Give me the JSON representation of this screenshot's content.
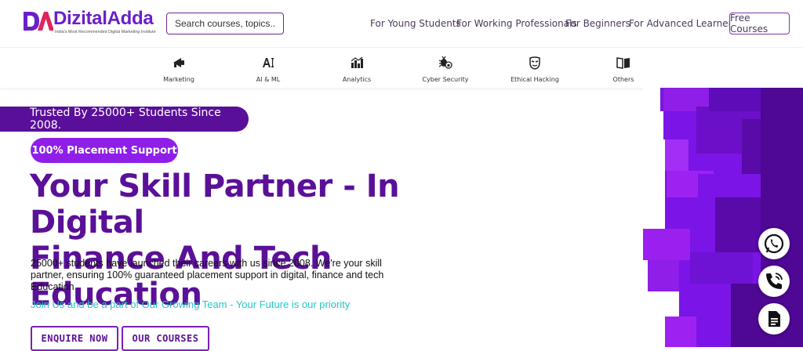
{
  "brand": {
    "name": "DizitalAdda",
    "tagline": "India's Most Recommended Digital Marketing Institute"
  },
  "search": {
    "placeholder": "Search courses, topics..."
  },
  "nav": {
    "links": [
      "For Young Students",
      "For Working Professionals",
      "For Beginners",
      "For Advanced Learners"
    ],
    "free_courses": "Free Courses"
  },
  "categories": [
    {
      "label": "Marketing",
      "icon": "megaphone-icon"
    },
    {
      "label": "AI & ML",
      "icon": "ai-icon"
    },
    {
      "label": "Analytics",
      "icon": "bar-chart-icon"
    },
    {
      "label": "Cyber Security",
      "icon": "bug-lock-icon"
    },
    {
      "label": "Ethical Hacking",
      "icon": "hacker-mask-icon"
    },
    {
      "label": "Others",
      "icon": "open-book-icon"
    }
  ],
  "hero": {
    "trusted": "Trusted By 25000+ Students Since 2008.",
    "badge": "100% Placement Support",
    "headline_line1": "Your Skill Partner - In Digital",
    "headline_line2": "Finance And Tech Education",
    "description": "25000+ students have launched their careers with us since 2008. We're your skill partner, ensuring 100% guaranteed placement support in digital, finance and tech Education",
    "join": "Join Us and be a part of Our Growing Team - Your Future is our priority",
    "enquire": "ENQUIRE NOW",
    "courses": "OUR COURSES"
  },
  "floating": [
    {
      "icon": "whatsapp-icon"
    },
    {
      "icon": "phone-call-icon"
    },
    {
      "icon": "document-icon"
    }
  ],
  "colors": {
    "brand_purple": "#5b1098",
    "accent_violet": "#8f1ee8",
    "teal": "#25c6c6"
  }
}
